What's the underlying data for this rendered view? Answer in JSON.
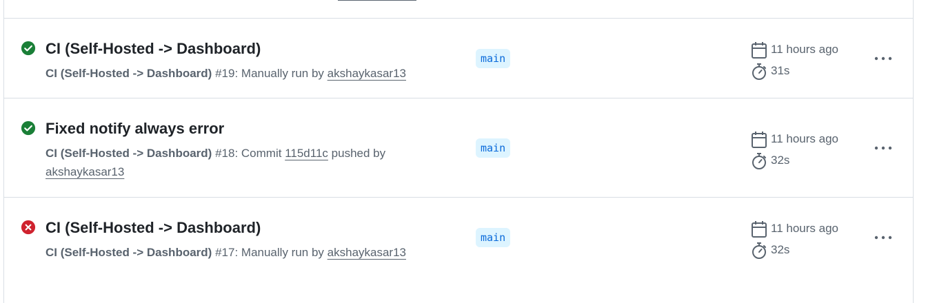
{
  "runs": [
    {
      "status": "success",
      "title": "CI (Self-Hosted -> Dashboard)",
      "workflow": "CI (Self-Hosted -> Dashboard)",
      "run_number": "#19:",
      "trigger_text": "Manually run by",
      "commit": "",
      "actor": "akshaykasar13",
      "branch": "main",
      "when": "11 hours ago",
      "duration": "31s"
    },
    {
      "status": "success",
      "title": "Fixed notify always error",
      "workflow": "CI (Self-Hosted -> Dashboard)",
      "run_number": "#18:",
      "trigger_text": "Commit",
      "commit": "115d11c",
      "pushed_text": "pushed by",
      "actor": "akshaykasar13",
      "branch": "main",
      "when": "11 hours ago",
      "duration": "32s"
    },
    {
      "status": "failure",
      "title": "CI (Self-Hosted -> Dashboard)",
      "workflow": "CI (Self-Hosted -> Dashboard)",
      "run_number": "#17:",
      "trigger_text": "Manually run by",
      "commit": "",
      "actor": "akshaykasar13",
      "branch": "main",
      "when": "11 hours ago",
      "duration": "32s"
    }
  ],
  "icons": {
    "success": "check-circle-fill-icon",
    "failure": "x-circle-fill-icon",
    "date": "calendar-icon",
    "duration": "stopwatch-icon",
    "menu": "kebab-horizontal-icon"
  },
  "colors": {
    "success": "#1a7f37",
    "failure": "#cf222e",
    "branch_bg": "#ddf4ff",
    "branch_fg": "#0969da",
    "muted": "#59636e",
    "border": "#d8dee4"
  }
}
